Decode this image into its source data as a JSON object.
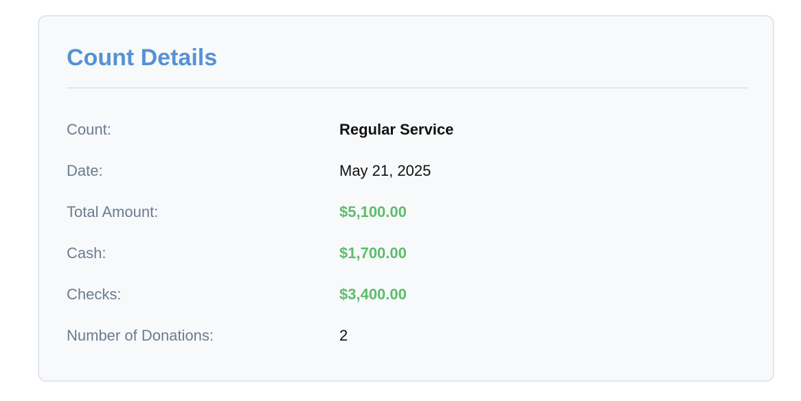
{
  "card": {
    "title": "Count Details"
  },
  "details": [
    {
      "label": "Count:",
      "value": "Regular Service"
    },
    {
      "label": "Date:",
      "value": "May 21, 2025"
    },
    {
      "label": "Total Amount:",
      "value": "$5,100.00"
    },
    {
      "label": "Cash:",
      "value": "$1,700.00"
    },
    {
      "label": "Checks:",
      "value": "$3,400.00"
    },
    {
      "label": "Number of Donations:",
      "value": "2"
    }
  ],
  "colors": {
    "title": "#5592d4",
    "label": "#6c7b8f",
    "money": "#5cbd6a",
    "card_background": "#f7f9fb",
    "card_border": "#e1e6ec"
  }
}
